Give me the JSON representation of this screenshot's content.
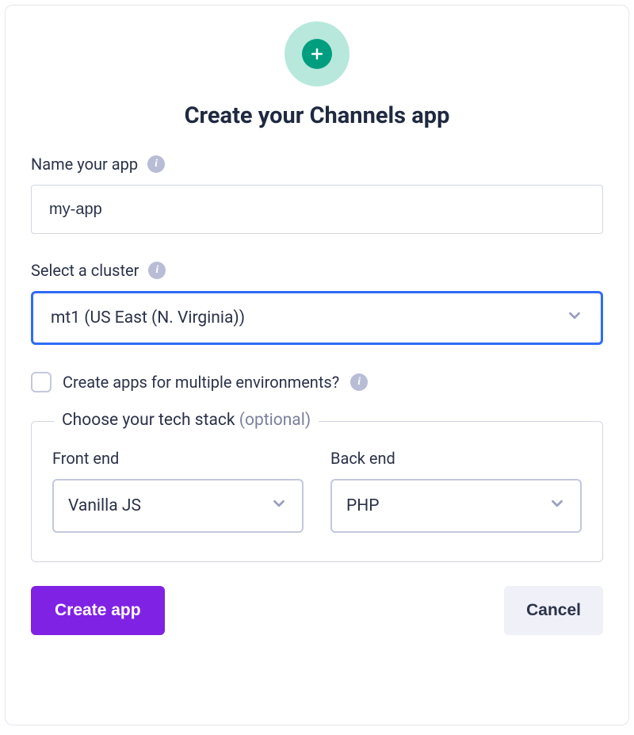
{
  "header": {
    "title": "Create your Channels app"
  },
  "name_field": {
    "label": "Name your app",
    "value": "my-app"
  },
  "cluster_field": {
    "label": "Select a cluster",
    "selected": "mt1 (US East (N. Virginia))"
  },
  "multi_env": {
    "label": "Create apps for multiple environments?"
  },
  "tech_stack": {
    "legend": "Choose your tech stack",
    "optional_label": "(optional)",
    "front_end": {
      "label": "Front end",
      "selected": "Vanilla JS"
    },
    "back_end": {
      "label": "Back end",
      "selected": "PHP"
    }
  },
  "buttons": {
    "primary": "Create app",
    "secondary": "Cancel"
  }
}
